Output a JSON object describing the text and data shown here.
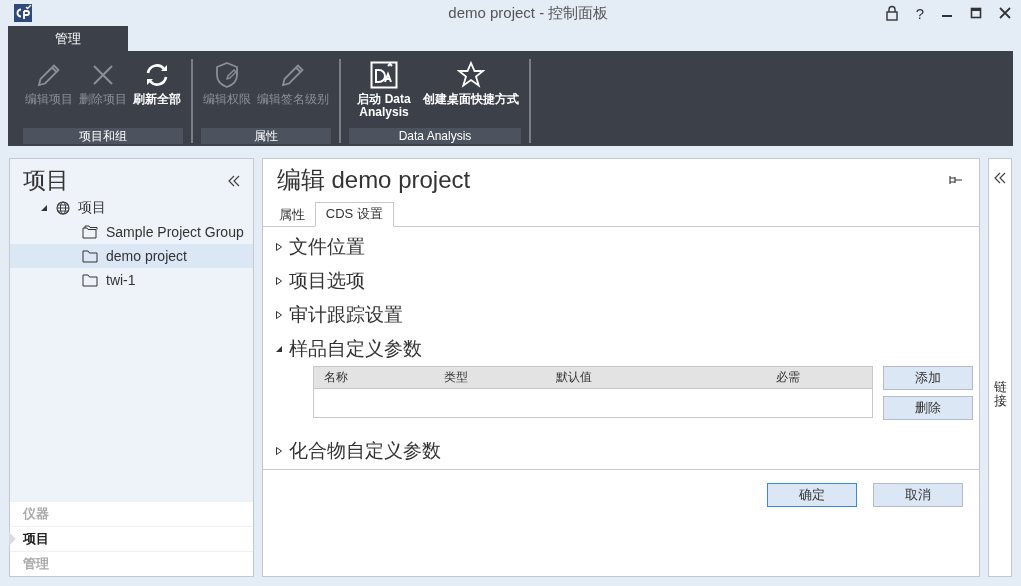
{
  "window": {
    "title": "demo project - 控制面板",
    "help_label": "?"
  },
  "ribbon_tabs": [
    {
      "label": "管理",
      "selected": true
    }
  ],
  "ribbon_groups": [
    {
      "label": "项目和组",
      "buttons": [
        {
          "label": "编辑项目",
          "kind": "pencil",
          "disabled": true
        },
        {
          "label": "删除项目",
          "kind": "cross",
          "disabled": true
        },
        {
          "label": "刷新全部",
          "kind": "refresh",
          "disabled": false
        }
      ]
    },
    {
      "label": "属性",
      "buttons": [
        {
          "label": "编辑权限",
          "kind": "shield",
          "disabled": true
        },
        {
          "label": "编辑签名级别",
          "kind": "pencil",
          "disabled": true
        }
      ]
    },
    {
      "label": "Data Analysis",
      "buttons": [
        {
          "label": "启动 Data Analysis",
          "kind": "da",
          "disabled": false
        },
        {
          "label": "创建桌面快捷方式",
          "kind": "star",
          "disabled": false
        }
      ]
    }
  ],
  "project_panel": {
    "title": "项目",
    "tree": [
      {
        "label": "项目",
        "kind": "globe",
        "expanded": true,
        "selected": false,
        "children": [
          {
            "label": "Sample Project Group",
            "kind": "folder-group",
            "selected": false
          },
          {
            "label": "demo project",
            "kind": "folder",
            "selected": true
          },
          {
            "label": "twi-1",
            "kind": "folder",
            "selected": false
          }
        ]
      }
    ]
  },
  "nav": [
    {
      "label": "仪器",
      "selected": false
    },
    {
      "label": "项目",
      "selected": true
    },
    {
      "label": "管理",
      "selected": false
    }
  ],
  "editor": {
    "title": "编辑 demo project",
    "tabs": [
      {
        "label": "属性",
        "selected": false
      },
      {
        "label": "CDS 设置",
        "selected": true
      }
    ],
    "sections": [
      {
        "label": "文件位置",
        "expanded": false
      },
      {
        "label": "项目选项",
        "expanded": false
      },
      {
        "label": "审计跟踪设置",
        "expanded": false
      },
      {
        "label": "样品自定义参数",
        "expanded": true,
        "table": {
          "columns": [
            "名称",
            "类型",
            "默认值",
            "必需"
          ]
        },
        "buttons": [
          "添加",
          "删除"
        ]
      },
      {
        "label": "化合物自定义参数",
        "expanded": false
      }
    ],
    "buttons": [
      {
        "label": "确定",
        "default": true
      },
      {
        "label": "取消",
        "default": false
      }
    ]
  },
  "side_panel": {
    "title": "链接"
  }
}
